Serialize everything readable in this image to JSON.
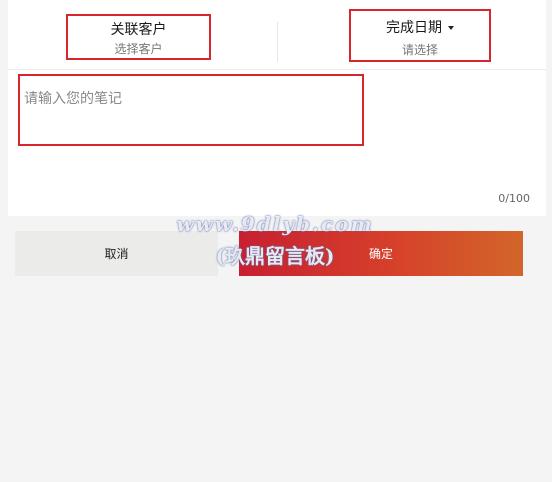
{
  "header": {
    "customer": {
      "title": "关联客户",
      "subtitle": "选择客户"
    },
    "date": {
      "title": "完成日期",
      "subtitle": "请选择"
    }
  },
  "note": {
    "placeholder": "请输入您的笔记",
    "value": "",
    "counter": "0/100"
  },
  "actions": {
    "cancel_label": "取消",
    "confirm_label": "确定"
  },
  "watermark": {
    "url": "www.9dlyb.com",
    "name": "(玖鼎留言板)"
  },
  "colors": {
    "highlight_border": "#d9252c",
    "confirm_gradient_start": "#c81f31",
    "confirm_gradient_end": "#d2662a"
  }
}
